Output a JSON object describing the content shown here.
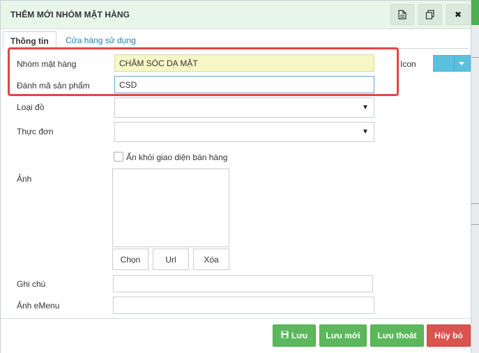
{
  "dialog": {
    "title": "THÊM MỚI NHÓM MẶT HÀNG",
    "title_buttons": [
      {
        "icon": "document-icon"
      },
      {
        "icon": "copy-icon"
      },
      {
        "icon": "close-icon",
        "glyph": "✖"
      }
    ]
  },
  "tabs": [
    {
      "label": "Thông tin",
      "active": true
    },
    {
      "label": "Cửa hàng sử dụng",
      "active": false
    }
  ],
  "form": {
    "group_name": {
      "label": "Nhóm mặt hàng",
      "value": "CHĂM SÓC DA MẶT"
    },
    "product_code": {
      "label": "Đánh mã sản phẩm",
      "value": "CSD"
    },
    "icon": {
      "label": "Icon"
    },
    "item_type": {
      "label": "Loại đồ",
      "value": ""
    },
    "menu": {
      "label": "Thực đơn",
      "value": ""
    },
    "hide_checkbox": {
      "label": "Ẩn khỏi giao diện bán hàng",
      "checked": false
    },
    "image": {
      "label": "Ảnh",
      "buttons": [
        "Chọn",
        "Url",
        "Xóa"
      ]
    },
    "note": {
      "label": "Ghi chú",
      "value": ""
    },
    "emenu_image": {
      "label": "Ảnh eMenu",
      "value": ""
    }
  },
  "footer": {
    "save": "Lưu",
    "save_new": "Lưu mới",
    "save_exit": "Lưu thoát",
    "cancel": "Hủy bỏ"
  },
  "colors": {
    "title_bg": "#e8f5e9",
    "highlight": "#e04545",
    "input_highlight": "#f6f7c6",
    "green_button": "#5cb85c",
    "red_button": "#d9534f",
    "icon_button": "#5bc0de",
    "tab_link": "#2a7ab9"
  }
}
